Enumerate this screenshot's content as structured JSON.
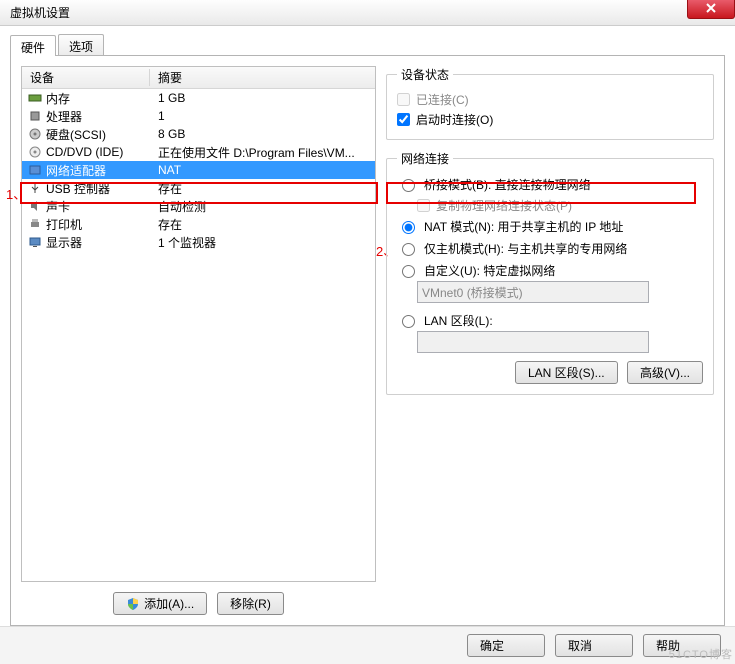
{
  "window": {
    "title": "虚拟机设置"
  },
  "tabs": {
    "hardware": "硬件",
    "options": "选项"
  },
  "headers": {
    "device": "设备",
    "summary": "摘要"
  },
  "rows": [
    {
      "icon": "memory-icon",
      "name": "内存",
      "summary": "1 GB"
    },
    {
      "icon": "cpu-icon",
      "name": "处理器",
      "summary": "1"
    },
    {
      "icon": "disk-icon",
      "name": "硬盘(SCSI)",
      "summary": "8 GB"
    },
    {
      "icon": "cd-icon",
      "name": "CD/DVD (IDE)",
      "summary": "正在使用文件 D:\\Program Files\\VM..."
    },
    {
      "icon": "nic-icon",
      "name": "网络适配器",
      "summary": "NAT",
      "selected": true
    },
    {
      "icon": "usb-icon",
      "name": "USB 控制器",
      "summary": "存在"
    },
    {
      "icon": "sound-icon",
      "name": "声卡",
      "summary": "自动检测"
    },
    {
      "icon": "printer-icon",
      "name": "打印机",
      "summary": "存在"
    },
    {
      "icon": "display-icon",
      "name": "显示器",
      "summary": "1 个监视器"
    }
  ],
  "left_buttons": {
    "add": "添加(A)...",
    "remove": "移除(R)"
  },
  "annotations": {
    "one": "1、",
    "two": "2、"
  },
  "status_group": {
    "legend": "设备状态",
    "connected": "已连接(C)",
    "connect_on_power": "启动时连接(O)"
  },
  "net_group": {
    "legend": "网络连接",
    "bridged": "桥接模式(B): 直接连接物理网络",
    "replicate": "复制物理网络连接状态(P)",
    "nat": "NAT 模式(N): 用于共享主机的 IP 地址",
    "hostonly": "仅主机模式(H): 与主机共享的专用网络",
    "custom": "自定义(U): 特定虚拟网络",
    "custom_value": "VMnet0 (桥接模式)",
    "lan_segment": "LAN 区段(L):",
    "lan_btn": "LAN 区段(S)...",
    "advanced": "高级(V)..."
  },
  "bottom": {
    "ok": "确定",
    "cancel": "取消",
    "help": "帮助"
  },
  "watermark": "51CTO博客"
}
